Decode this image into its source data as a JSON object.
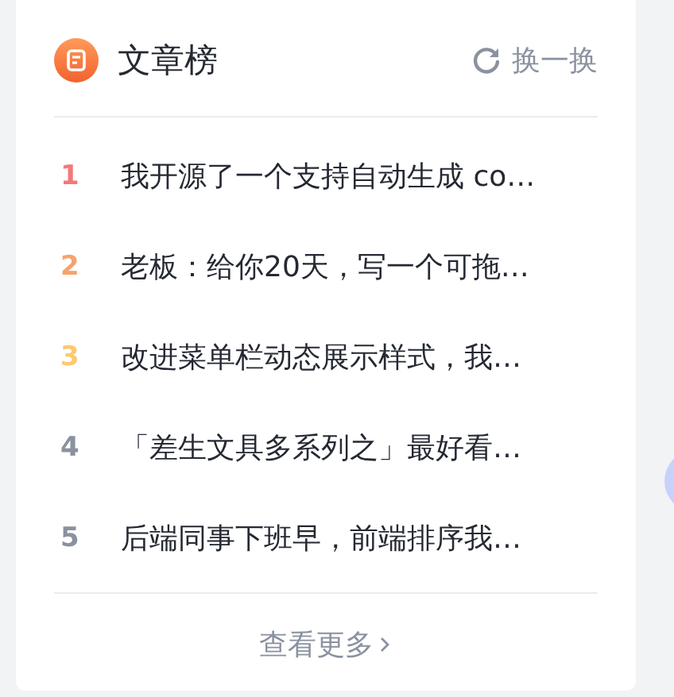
{
  "card": {
    "title": "文章榜",
    "refresh": "换一换",
    "items": [
      {
        "rank": "1",
        "color": "#f5787c",
        "title": "我开源了一个支持自动生成 co…"
      },
      {
        "rank": "2",
        "color": "#f7a26c",
        "title": "老板：给你20天，写一个可拖…"
      },
      {
        "rank": "3",
        "color": "#fbc96e",
        "title": "改进菜单栏动态展示样式，我…"
      },
      {
        "rank": "4",
        "color": "#8a919f",
        "title": "「差生文具多系列之」最好看…"
      },
      {
        "rank": "5",
        "color": "#8a919f",
        "title": "后端同事下班早，前端排序我…"
      }
    ],
    "more": "查看更多"
  }
}
